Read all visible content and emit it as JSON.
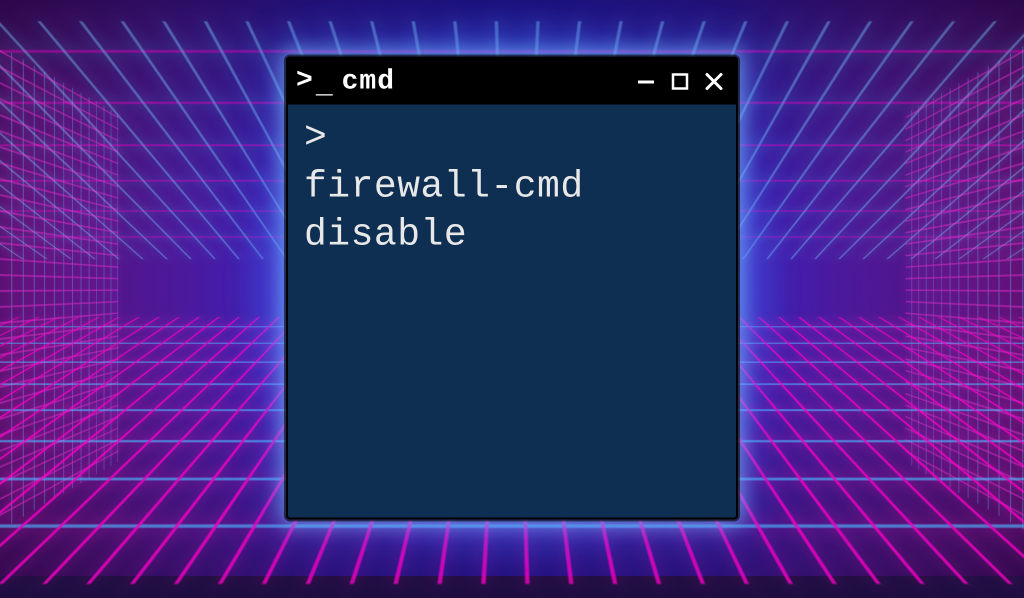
{
  "window": {
    "title": "cmd",
    "icon_name": "terminal-prompt-icon"
  },
  "terminal": {
    "prompt_symbol": ">",
    "command": "firewall-cmd disable"
  },
  "colors": {
    "titlebar_bg": "#000000",
    "terminal_bg": "#0e2f52",
    "terminal_fg": "#e8e8e8",
    "glow_cyan": "#58c4ff",
    "glow_magenta": "#ff1ec8"
  }
}
